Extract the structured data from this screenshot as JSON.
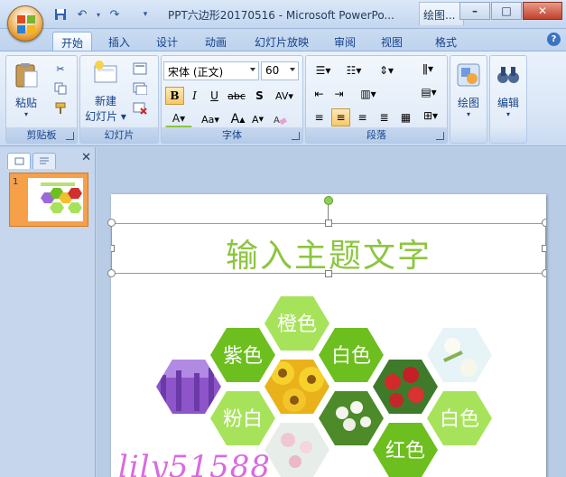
{
  "titlebar": {
    "title": "PPT六边形20170516 - Microsoft PowerPo...",
    "context_tab": "绘图...",
    "minimize": "–",
    "maximize": "□",
    "close": "✕"
  },
  "qat": {
    "save_icon": "save-icon",
    "undo_icon": "undo-icon",
    "redo_icon": "redo-icon",
    "customize_icon": "customize-icon"
  },
  "tabs": [
    "开始",
    "插入",
    "设计",
    "动画",
    "幻灯片放映",
    "审阅",
    "视图",
    "格式"
  ],
  "ribbon": {
    "clipboard": {
      "label": "剪贴板",
      "paste": "粘贴"
    },
    "slides": {
      "label": "幻灯片",
      "new_slide_line1": "新建",
      "new_slide_line2": "幻灯片"
    },
    "font": {
      "label": "字体",
      "font_name": "宋体 (正文)",
      "font_size": "60",
      "bold": "B",
      "italic": "I",
      "underline": "U",
      "strike": "abc",
      "shadow": "S",
      "spacing": "AV",
      "font_color": "A",
      "case": "Aa",
      "grow": "A",
      "shrink": "A"
    },
    "paragraph": {
      "label": "段落"
    },
    "drawing": {
      "label": "绘图"
    },
    "editing": {
      "label": "编辑"
    }
  },
  "slide_panel": {
    "slide_number": "1"
  },
  "slide": {
    "title": "输入主题文字",
    "hexagons": [
      {
        "text": "橙色",
        "fill": "#a7e35a"
      },
      {
        "text": "紫色",
        "fill": "#6cbf1e"
      },
      {
        "text": "白色",
        "fill": "#6cbf1e"
      },
      {
        "text": "粉白",
        "fill": "#a7e35a"
      },
      {
        "text": "白色",
        "fill": "#a7e35a"
      },
      {
        "text": "红色",
        "fill": "#6cbf1e"
      }
    ],
    "watermark": "lily51588"
  },
  "colors": {
    "accent_green": "#8cc63f",
    "ribbon_blue": "#15428b"
  }
}
